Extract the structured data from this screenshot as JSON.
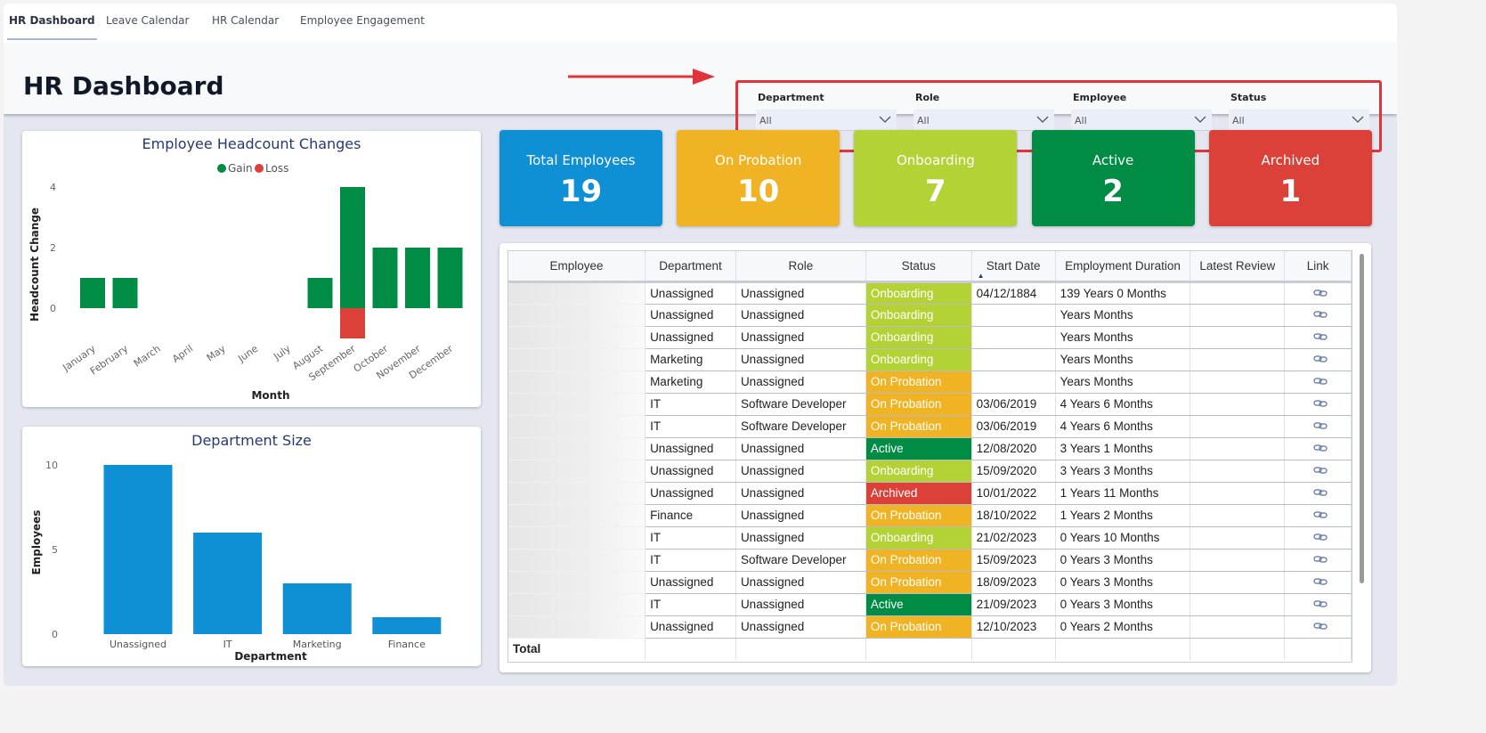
{
  "tabs": [
    {
      "label": "HR Dashboard",
      "active": true
    },
    {
      "label": "Leave Calendar"
    },
    {
      "label": "HR Calendar"
    },
    {
      "label": "Employee Engagement"
    }
  ],
  "header": {
    "title": "HR Dashboard"
  },
  "filters": [
    {
      "label": "Department",
      "value": "All"
    },
    {
      "label": "Role",
      "value": "All"
    },
    {
      "label": "Employee",
      "value": "All"
    },
    {
      "label": "Status",
      "value": "All"
    }
  ],
  "kpis": [
    {
      "label": "Total Employees",
      "value": "19",
      "color": "#0f8fd4"
    },
    {
      "label": "On Probation",
      "value": "10",
      "color": "#f0b323"
    },
    {
      "label": "Onboarding",
      "value": "7",
      "color": "#b3d235"
    },
    {
      "label": "Active",
      "value": "2",
      "color": "#008c45"
    },
    {
      "label": "Archived",
      "value": "1",
      "color": "#dc4139"
    }
  ],
  "status_colors": {
    "Onboarding": "#b3d235",
    "On Probation": "#f0b323",
    "Active": "#008c45",
    "Archived": "#dc4139"
  },
  "chart_data": [
    {
      "type": "bar",
      "title": "Employee Headcount Changes",
      "xlabel": "Month",
      "ylabel": "Headcount Change",
      "categories": [
        "January",
        "February",
        "March",
        "April",
        "May",
        "June",
        "July",
        "August",
        "September",
        "October",
        "November",
        "December"
      ],
      "series": [
        {
          "name": "Gain",
          "color": "#008c45",
          "values": [
            1,
            1,
            0,
            0,
            0,
            0,
            0,
            1,
            4,
            2,
            2,
            2
          ]
        },
        {
          "name": "Loss",
          "color": "#dc4139",
          "values": [
            0,
            0,
            0,
            0,
            0,
            0,
            0,
            0,
            -1,
            0,
            0,
            0
          ]
        }
      ],
      "yticks": [
        "0",
        "2",
        "4"
      ],
      "ylim": [
        -1,
        4
      ],
      "legend": "top-center",
      "grid": false
    },
    {
      "type": "bar",
      "title": "Department Size",
      "xlabel": "Department",
      "ylabel": "Employees",
      "categories": [
        "Unassigned",
        "IT",
        "Marketing",
        "Finance"
      ],
      "values": [
        10,
        6,
        3,
        1
      ],
      "color": "#0f8fd4",
      "yticks": [
        "0",
        "5",
        "10"
      ],
      "ylim": [
        0,
        10
      ],
      "grid": false
    }
  ],
  "table": {
    "columns": [
      "Employee",
      "Department",
      "Role",
      "Status",
      "Start Date",
      "Employment Duration",
      "Latest Review",
      "Link"
    ],
    "rows": [
      [
        "",
        "Unassigned",
        "Unassigned",
        "Onboarding",
        "04/12/1884",
        "139 Years 0 Months",
        ""
      ],
      [
        "",
        "Unassigned",
        "Unassigned",
        "Onboarding",
        "",
        "Years Months",
        ""
      ],
      [
        "",
        "Unassigned",
        "Unassigned",
        "Onboarding",
        "",
        "Years Months",
        ""
      ],
      [
        "",
        "Marketing",
        "Unassigned",
        "Onboarding",
        "",
        "Years Months",
        ""
      ],
      [
        "",
        "Marketing",
        "Unassigned",
        "On Probation",
        "",
        "Years Months",
        ""
      ],
      [
        "",
        "IT",
        "Software Developer",
        "On Probation",
        "03/06/2019",
        "4 Years 6 Months",
        ""
      ],
      [
        "",
        "IT",
        "Software Developer",
        "On Probation",
        "03/06/2019",
        "4 Years 6 Months",
        ""
      ],
      [
        "",
        "Unassigned",
        "Unassigned",
        "Active",
        "12/08/2020",
        "3 Years 1 Months",
        ""
      ],
      [
        "",
        "Unassigned",
        "Unassigned",
        "Onboarding",
        "15/09/2020",
        "3 Years 3 Months",
        ""
      ],
      [
        "",
        "Unassigned",
        "Unassigned",
        "Archived",
        "10/01/2022",
        "1 Years 11 Months",
        ""
      ],
      [
        "",
        "Finance",
        "Unassigned",
        "On Probation",
        "18/10/2022",
        "1 Years 2 Months",
        ""
      ],
      [
        "",
        "IT",
        "Unassigned",
        "Onboarding",
        "21/02/2023",
        "0 Years 10 Months",
        ""
      ],
      [
        "",
        "IT",
        "Software Developer",
        "On Probation",
        "15/09/2023",
        "0 Years 3 Months",
        ""
      ],
      [
        "",
        "Unassigned",
        "Unassigned",
        "On Probation",
        "18/09/2023",
        "0 Years 3 Months",
        ""
      ],
      [
        "",
        "IT",
        "Unassigned",
        "Active",
        "21/09/2023",
        "0 Years 3 Months",
        ""
      ],
      [
        "",
        "Unassigned",
        "Unassigned",
        "On Probation",
        "12/10/2023",
        "0 Years 2 Months",
        ""
      ]
    ],
    "total_label": "Total",
    "sort": {
      "column": "Start Date",
      "direction": "ascending"
    }
  }
}
